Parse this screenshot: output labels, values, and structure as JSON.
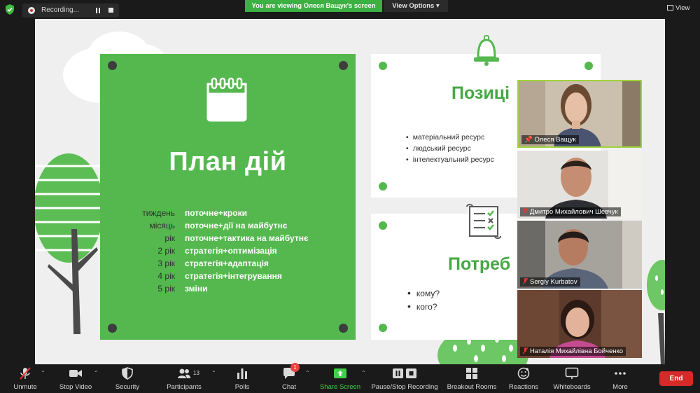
{
  "topbar": {
    "recording_label": "Recording...",
    "viewing_banner": "You are viewing Олеся Ващук's screen",
    "view_options": "View Options",
    "view": "View"
  },
  "slide": {
    "plan_title": "План дій",
    "plan_rows": [
      {
        "period": "тиждень",
        "action": "поточне+кроки"
      },
      {
        "period": "місяць",
        "action": "поточне+дії на майбутнє"
      },
      {
        "period": "рік",
        "action": "поточне+тактика на майбутнє"
      },
      {
        "period": "2 рік",
        "action": "стратегія+оптимізація"
      },
      {
        "period": "3 рік",
        "action": "стратегія+адаптація"
      },
      {
        "period": "4 рік",
        "action": "стратегія+інтегрування"
      },
      {
        "period": "5 рік",
        "action": "зміни"
      }
    ],
    "card_top_title": "Позиці",
    "card_top_items": [
      "матеріальний ресурс",
      "людський ресурс",
      "інтелектуальний ресурс"
    ],
    "card_bottom_title": "Потреб",
    "card_bottom_items": [
      "кому?",
      "кого?"
    ]
  },
  "participants": [
    {
      "name": "Олеся Ващук",
      "muted": false,
      "active": true
    },
    {
      "name": "Дмитро Михайлович Шевчук",
      "muted": true,
      "active": false
    },
    {
      "name": "Sergiy Kurbatov",
      "muted": true,
      "active": false
    },
    {
      "name": "Наталія Михайлівна Бойченко",
      "muted": true,
      "active": false
    }
  ],
  "toolbar": {
    "unmute": "Unmute",
    "stop_video": "Stop Video",
    "security": "Security",
    "participants": "Participants",
    "participants_count": "13",
    "polls": "Polls",
    "chat": "Chat",
    "chat_badge": "1",
    "share_screen": "Share Screen",
    "pause_stop_recording": "Pause/Stop Recording",
    "breakout_rooms": "Breakout Rooms",
    "reactions": "Reactions",
    "whiteboards": "Whiteboards",
    "more": "More",
    "end": "End"
  },
  "colors": {
    "brand_green": "#55b84f",
    "banner_green": "#3cb043",
    "end_red": "#d42a2a",
    "active_speaker": "#9fd43c"
  }
}
